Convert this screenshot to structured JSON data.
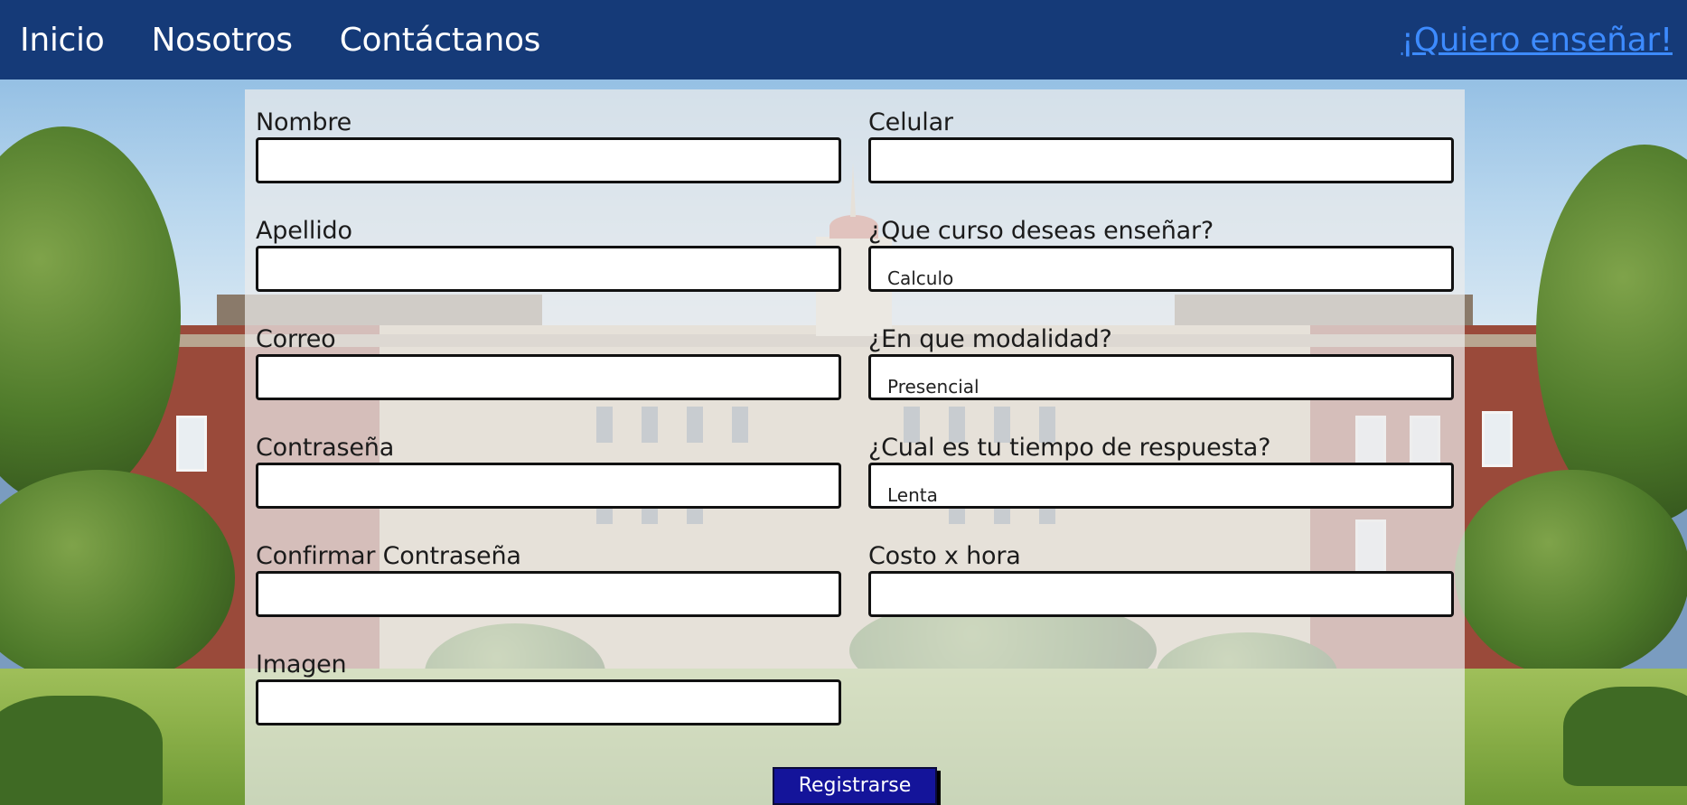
{
  "nav": {
    "links": [
      "Inicio",
      "Nosotros",
      "Contáctanos"
    ],
    "cta": "¡Quiero enseñar!",
    "background_color": "#153a78",
    "cta_color": "#3d8bff"
  },
  "form": {
    "left_fields": [
      {
        "label": "Nombre",
        "value": ""
      },
      {
        "label": "Apellido",
        "value": ""
      },
      {
        "label": "Correo",
        "value": ""
      },
      {
        "label": "Contraseña",
        "value": ""
      },
      {
        "label": "Confirmar Contraseña",
        "value": ""
      },
      {
        "label": "Imagen",
        "value": ""
      }
    ],
    "right_fields": [
      {
        "label": "Celular",
        "type": "input",
        "value": ""
      },
      {
        "label": "¿Que curso deseas enseñar?",
        "type": "select",
        "selected": "Calculo"
      },
      {
        "label": "¿En que modalidad?",
        "type": "select",
        "selected": "Presencial"
      },
      {
        "label": "¿Cual es tu tiempo de respuesta?",
        "type": "select",
        "selected": "Lenta"
      },
      {
        "label": "Costo x hora",
        "type": "input",
        "value": ""
      }
    ],
    "submit_label": "Registrarse",
    "submit_color": "#14149a"
  }
}
